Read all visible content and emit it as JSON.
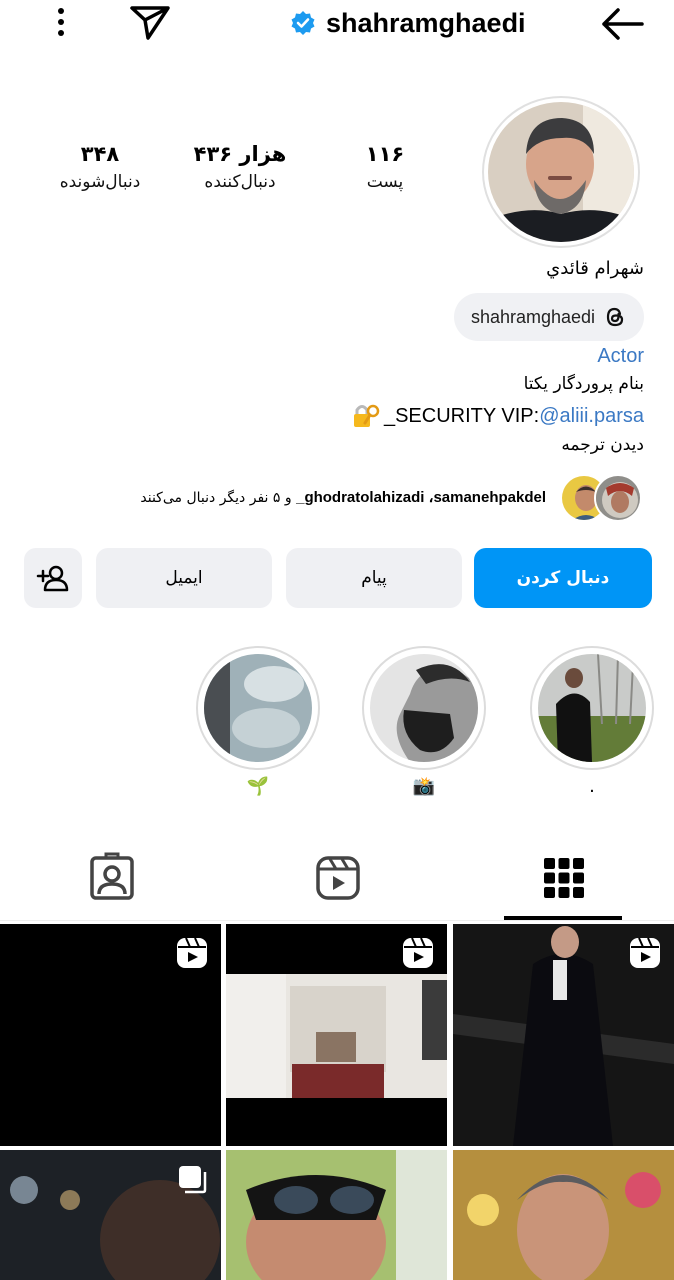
{
  "header": {
    "username": "shahramghaedi",
    "verified": true
  },
  "stats": {
    "posts": {
      "value": "۱۱۶",
      "label": "پست"
    },
    "followers": {
      "value": "۴۳۶ هزار",
      "label": "دنبال‌کننده"
    },
    "following": {
      "value": "۳۴۸",
      "label": "دنبال‌شونده"
    }
  },
  "profile": {
    "full_name": "شهرام قائدي",
    "threads_handle": "shahramghaedi",
    "category": "Actor",
    "bio_line1": "بنام پروردگار یکتا",
    "bio_line2_text": "_SECURITY VIP:",
    "bio_line2_mention": "@aliii.parsa",
    "see_translation": "دیدن ترجمه"
  },
  "followed_by": {
    "prefix": "",
    "names": "ghodratolahizadi ،samanehpakdel_",
    "suffix": " و ۵ نفر دیگر دنبال می‌کنند"
  },
  "actions": {
    "follow": "دنبال کردن",
    "message": "پیام",
    "email": "ایمیل"
  },
  "highlights": [
    {
      "label": "."
    },
    {
      "label": "📸"
    },
    {
      "label": "🌱"
    }
  ],
  "colors": {
    "accent": "#0095f6",
    "link": "#3b79c4",
    "button_bg": "#eff0f3",
    "verified": "#1d9bf0"
  },
  "icons": {
    "header": [
      "more-icon",
      "send-icon",
      "verified-icon",
      "back-arrow-icon"
    ],
    "tabs": [
      "grid-icon",
      "reels-icon",
      "tagged-icon"
    ],
    "post_types": [
      "reel-icon",
      "reel-icon",
      "reel-icon",
      "carousel-icon",
      "",
      ""
    ]
  }
}
